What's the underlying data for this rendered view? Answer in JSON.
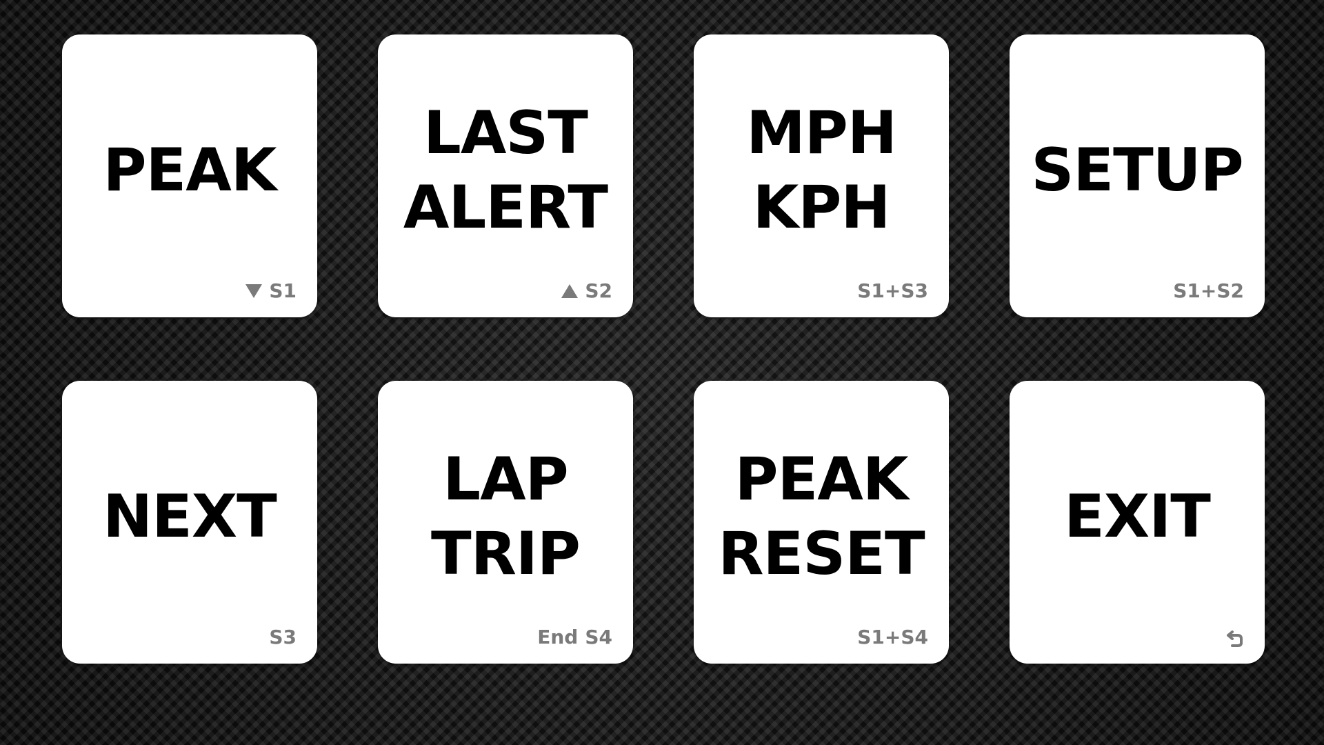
{
  "tiles": [
    {
      "lines": [
        "PEAK"
      ],
      "hint": "S1",
      "hint_icon": "triangle-down-icon"
    },
    {
      "lines": [
        "LAST",
        "ALERT"
      ],
      "hint": "S2",
      "hint_icon": "triangle-up-icon"
    },
    {
      "lines": [
        "MPH",
        "KPH"
      ],
      "hint": "S1+S3"
    },
    {
      "lines": [
        "SETUP"
      ],
      "hint": "S1+S2"
    },
    {
      "lines": [
        "NEXT"
      ],
      "hint": "S3"
    },
    {
      "lines": [
        "LAP",
        "TRIP"
      ],
      "hint_prefix": "End",
      "hint": "S4"
    },
    {
      "lines": [
        "PEAK",
        "RESET"
      ],
      "hint": "S1+S4"
    },
    {
      "lines": [
        "EXIT"
      ],
      "hint_icon": "return-arrow-icon"
    }
  ],
  "colors": {
    "tile_bg": "#ffffff",
    "label": "#000000",
    "hint": "#7a7a7a",
    "background": "#161616"
  }
}
